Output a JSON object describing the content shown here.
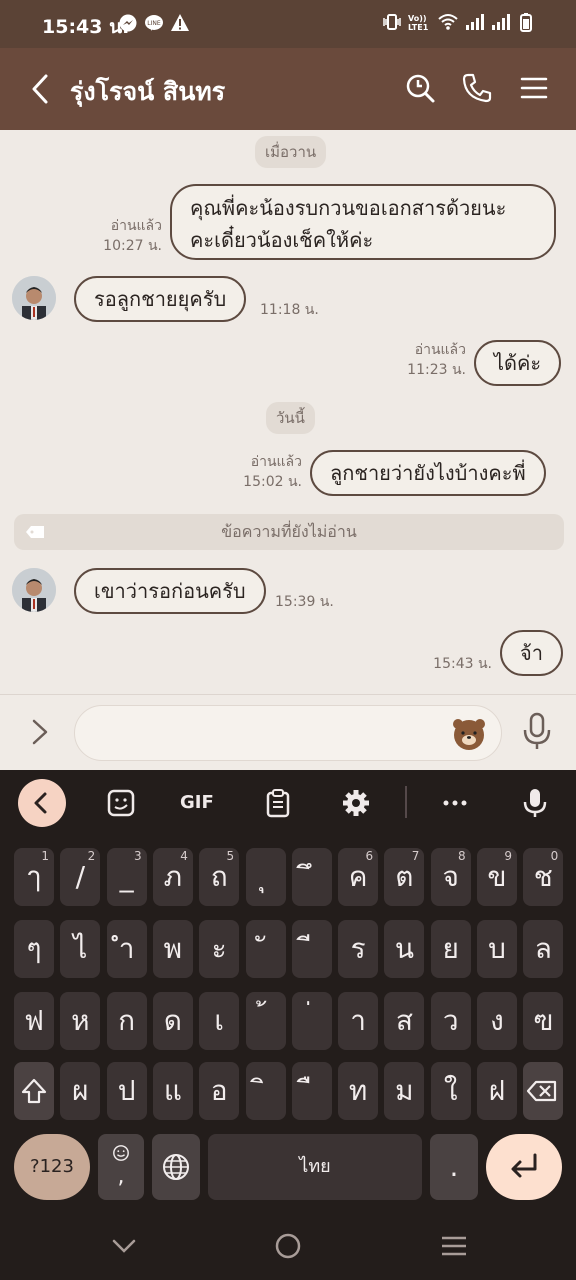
{
  "status_bar": {
    "time": "15:43 น.",
    "left_icons": [
      "messenger-icon",
      "line-icon",
      "warning-icon"
    ],
    "right_icons": [
      "vibrate-icon",
      "volte-icon",
      "wifi-icon",
      "signal-icon",
      "signal-icon",
      "battery-icon"
    ],
    "volte_text": "Vo)) LTE1"
  },
  "header": {
    "title": "รุ่งโรจน์ สินทร",
    "icons": [
      "back-icon",
      "search-icon",
      "phone-icon",
      "menu-icon"
    ],
    "bg": "#6a4a3c"
  },
  "chat": {
    "date_yesterday": "เมื่อวาน",
    "date_today": "วันนี้",
    "unread_divider": "ข้อความที่ยังไม่อ่าน",
    "messages": [
      {
        "side": "right",
        "lines": [
          "คุณพี่คะน้องรบกวนขอเอกสารด้วยนะ",
          "คะเดี๋ยวน้องเช็คให้ค่ะ"
        ],
        "read": "อ่านแล้ว",
        "time": "10:27 น."
      },
      {
        "side": "left",
        "text": "รอลูกชายยุครับ",
        "time": "11:18 น."
      },
      {
        "side": "right",
        "text": "ได้ค่ะ",
        "read": "อ่านแล้ว",
        "time": "11:23 น."
      },
      {
        "side": "right",
        "text": "ลูกชายว่ายังไงบ้างคะพี่",
        "read": "อ่านแล้ว",
        "time": "15:02 น."
      },
      {
        "side": "left",
        "text": "เขาว่ารอก่อนครับ",
        "time": "15:39 น."
      },
      {
        "side": "right",
        "text": "จ้า",
        "time": "15:43 น."
      }
    ]
  },
  "input": {
    "placeholder": "",
    "icons": [
      "expand-icon",
      "brown-bear-emoji-icon",
      "microphone-icon"
    ]
  },
  "keyboard": {
    "toolbar_gif": "GIF",
    "toolbar_icons": [
      "collapse-icon",
      "sticker-icon",
      "gif-icon",
      "clipboard-icon",
      "settings-icon",
      "more-icon",
      "voice-input-icon"
    ],
    "row1": [
      {
        "k": "ๅ",
        "n": "1"
      },
      {
        "k": "/",
        "n": "2"
      },
      {
        "k": "_",
        "n": "3"
      },
      {
        "k": "ภ",
        "n": "4"
      },
      {
        "k": "ถ",
        "n": "5"
      },
      {
        "k": "ุ",
        "n": ""
      },
      {
        "k": "ึ",
        "n": ""
      },
      {
        "k": "ค",
        "n": "6"
      },
      {
        "k": "ต",
        "n": "7"
      },
      {
        "k": "จ",
        "n": "8"
      },
      {
        "k": "ข",
        "n": "9"
      },
      {
        "k": "ช",
        "n": "0"
      }
    ],
    "row2": [
      "ๆ",
      "ไ",
      "ำ",
      "พ",
      "ะ",
      "ั",
      "ี",
      "ร",
      "น",
      "ย",
      "บ",
      "ล"
    ],
    "row3": [
      "ฟ",
      "ห",
      "ก",
      "ด",
      "เ",
      "้",
      "่",
      "า",
      "ส",
      "ว",
      "ง",
      "ฃ"
    ],
    "row4": [
      "ผ",
      "ป",
      "แ",
      "อ",
      "ิ",
      "ื",
      "ท",
      "ม",
      "ใ",
      "ฝ"
    ],
    "symbols_label": "?123",
    "emoji_comma": ",",
    "space_label": "ไทย",
    "period": "."
  },
  "nav": {
    "icons": [
      "back-chevron-icon",
      "home-icon",
      "recents-icon"
    ]
  },
  "colors": {
    "accent": "#6a4a3c",
    "status_bar": "#5b4336",
    "chat_bg": "#efeae5",
    "keyboard_bg": "#231d1b",
    "key_bg": "#3b3333",
    "enter_key": "#fde0cf",
    "symbols_key": "#c7a996"
  }
}
